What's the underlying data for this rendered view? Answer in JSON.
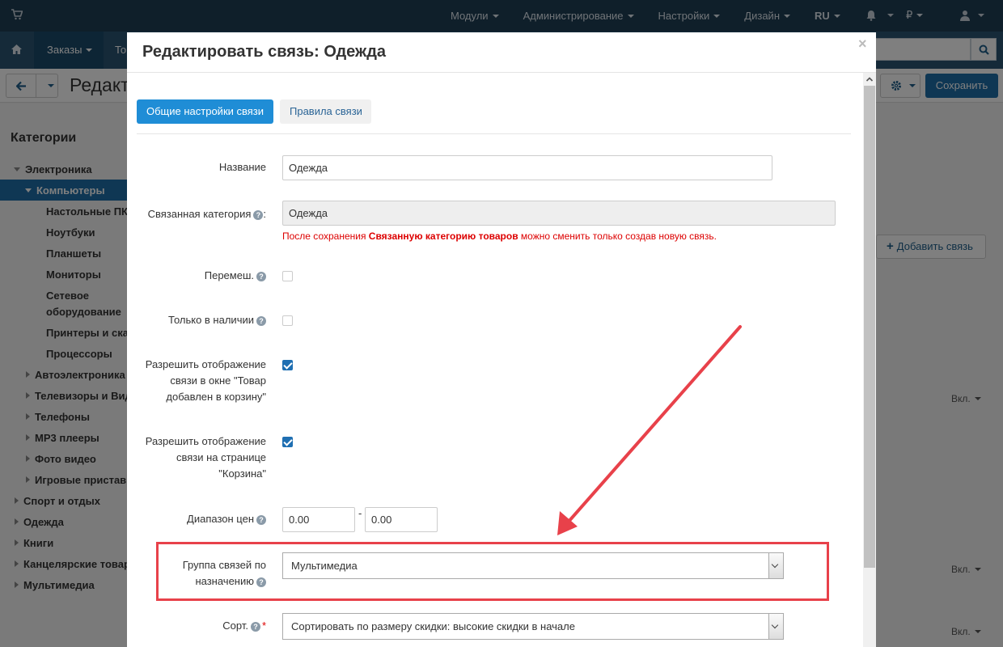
{
  "topbar": {
    "nav": [
      {
        "label": "Модули"
      },
      {
        "label": "Администрирование"
      },
      {
        "label": "Настройки"
      },
      {
        "label": "Дизайн"
      },
      {
        "label": "RU"
      },
      {
        "label": "₽"
      }
    ]
  },
  "subbar": {
    "orders": "Заказы",
    "orders2": "То"
  },
  "toolbar": {
    "title": "Редакт",
    "save": "Сохранить"
  },
  "sidebar": {
    "title": "Категории",
    "items": [
      {
        "label": "Электроника"
      },
      {
        "label": "Компьютеры"
      },
      {
        "label": "Настольные ПК"
      },
      {
        "label": "Ноутбуки"
      },
      {
        "label": "Планшеты"
      },
      {
        "label": "Мониторы"
      },
      {
        "label": "Сетевое"
      },
      {
        "label": "оборудование"
      },
      {
        "label": "Принтеры и ска"
      },
      {
        "label": "Процессоры"
      },
      {
        "label": "Автоэлектроника"
      },
      {
        "label": "Телевизоры и Вид"
      },
      {
        "label": "Телефоны"
      },
      {
        "label": "MP3 плееры"
      },
      {
        "label": "Фото видео"
      },
      {
        "label": "Игровые пристав"
      },
      {
        "label": "Спорт и отдых"
      },
      {
        "label": "Одежда"
      },
      {
        "label": "Книги"
      },
      {
        "label": "Канцелярские товар"
      },
      {
        "label": "Мультимедиа"
      }
    ]
  },
  "content": {
    "add_link": "Добавить связь",
    "status_labels": [
      "Вкл.",
      "Вкл.",
      "Вкл."
    ]
  },
  "modal": {
    "title": "Редактировать связь: Одежда",
    "close": "×",
    "tabs": [
      {
        "label": "Общие настройки связи",
        "active": true
      },
      {
        "label": "Правила связи",
        "active": false
      }
    ],
    "fields": {
      "name_label": "Название",
      "name_value": "Одежда",
      "category_label": "Связанная категория",
      "category_value": "Одежда",
      "note_pre": "После сохранения ",
      "note_bold": "Связанную категорию товаров",
      "note_post": " можно сменить только создав новую связь.",
      "shuffle_label": "Перемеш.",
      "shuffle_checked": false,
      "instock_label": "Только в наличии",
      "instock_checked": false,
      "cart_window_label_1": "Разрешить отображение",
      "cart_window_label_2": "связи в окне \"Товар",
      "cart_window_label_3": "добавлен в корзину\"",
      "cart_window_checked": true,
      "cart_page_label_1": "Разрешить отображение",
      "cart_page_label_2": "связи на странице",
      "cart_page_label_3": "\"Корзина\"",
      "cart_page_checked": true,
      "price_range_label": "Диапазон цен",
      "price_from": "0.00",
      "price_to": "0.00",
      "price_dash": "-",
      "group_label_1": "Группа связей по",
      "group_label_2": "назначению",
      "group_value": "Мультимедиа",
      "sort_label": "Сорт.",
      "sort_value": "Сортировать по размеру скидки: высокие скидки в начале"
    }
  },
  "colors": {
    "accent": "#1f8dd6",
    "annotation": "#e8414a",
    "topbar": "#1f3f55"
  }
}
